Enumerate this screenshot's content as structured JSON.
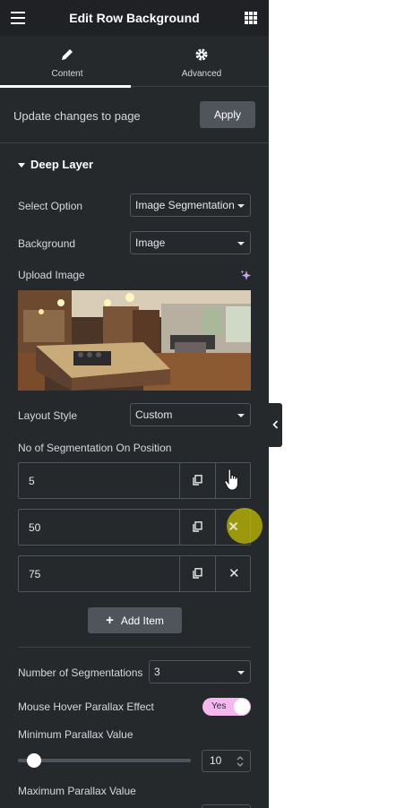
{
  "header": {
    "title": "Edit Row Background",
    "menu_icon": "hamburger-icon",
    "apps_icon": "grid-icon"
  },
  "tabs": [
    {
      "label": "Content",
      "icon": "pencil-icon",
      "active": true
    },
    {
      "label": "Advanced",
      "icon": "gear-icon",
      "active": false
    }
  ],
  "update_bar": {
    "text": "Update changes to page",
    "apply_label": "Apply"
  },
  "section": {
    "title": "Deep Layer"
  },
  "fields": {
    "select_option": {
      "label": "Select Option",
      "value": "Image Segmentation"
    },
    "background": {
      "label": "Background",
      "value": "Image"
    },
    "upload_image": {
      "label": "Upload Image",
      "ai_icon": "sparkle-icon"
    },
    "layout_style": {
      "label": "Layout Style",
      "value": "Custom"
    },
    "segmentation_position": {
      "label": "No of Segmentation On Position",
      "items": [
        "5",
        "50",
        "75"
      ],
      "add_label": "Add Item"
    },
    "number_of_segmentations": {
      "label": "Number of Segmentations",
      "value": "3"
    },
    "mouse_hover_parallax": {
      "label": "Mouse Hover Parallax Effect",
      "toggle_label": "Yes",
      "enabled": true
    },
    "min_parallax": {
      "label": "Minimum Parallax Value",
      "value": "10"
    },
    "max_parallax": {
      "label": "Maximum Parallax Value"
    }
  },
  "colors": {
    "panel": "#26292c",
    "header": "#1f2124",
    "toggle_on": "#f6b7ee",
    "button": "#4f555b",
    "highlight": "#c4be00"
  }
}
